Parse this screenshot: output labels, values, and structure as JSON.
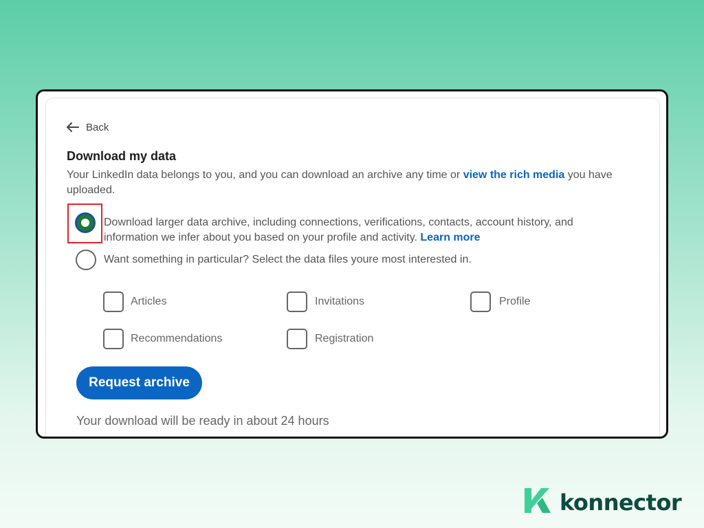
{
  "back": {
    "label": "Back"
  },
  "page": {
    "title": "Download my data",
    "desc_before": "Your LinkedIn data belongs to you, and you can download an archive any time or ",
    "desc_link": "view the rich media",
    "desc_after": " you have uploaded."
  },
  "options": {
    "full": {
      "text": "Download larger data archive, including connections, verifications, contacts, account history, and information we infer about you based on your profile and activity. ",
      "link": "Learn more",
      "selected": true
    },
    "partial": {
      "text": "Want something in particular? Select the data files youre most interested in.",
      "selected": false
    }
  },
  "checkboxes": [
    {
      "label": "Articles",
      "checked": false
    },
    {
      "label": "Invitations",
      "checked": false
    },
    {
      "label": "Profile",
      "checked": false
    },
    {
      "label": "Recommendations",
      "checked": false
    },
    {
      "label": "Registration",
      "checked": false
    }
  ],
  "request_button": {
    "label": "Request archive"
  },
  "ready_note": "Your download will be ready in about 24 hours",
  "brand": {
    "name": "konnector",
    "icon": "konnector-k-logo"
  },
  "colors": {
    "link": "#0a66c2",
    "button": "#0a66c2",
    "radio_selected_fill": "#1c7a36",
    "highlight_box": "#e0242b",
    "brand_text": "#0e4b3d",
    "brand_icon": "#3fcf98"
  },
  "icons": {
    "back": "arrow-left-icon"
  }
}
